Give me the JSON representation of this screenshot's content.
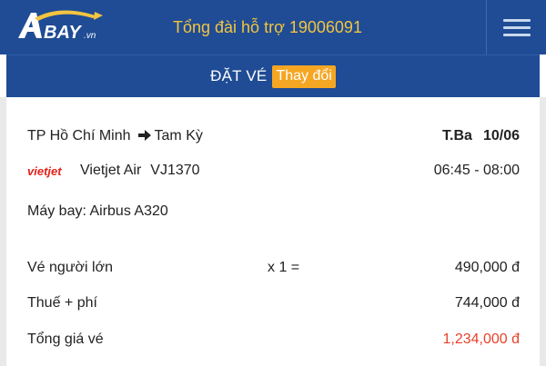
{
  "header": {
    "logo_text": "BAY",
    "logo_suffix": ".vn",
    "hotline": "Tổng đài hỗ trợ 19006091"
  },
  "subbar": {
    "title": "ĐẶT VÉ",
    "change_label": "Thay đổi"
  },
  "flight": {
    "origin": "TP Hồ Chí Minh",
    "destination": "Tam Kỳ",
    "weekday": "T.Ba",
    "date": "10/06",
    "airline_logo_text": "vietjet",
    "airline": "Vietjet Air",
    "flight_number": "VJ1370",
    "time_range": "06:45 - 08:00",
    "aircraft": "Máy bay: Airbus A320"
  },
  "pricing": {
    "adult_label": "Vé người lớn",
    "adult_qty": "x 1 =",
    "adult_price": "490,000 đ",
    "tax_label": "Thuế + phí",
    "tax_price": "744,000 đ",
    "total_label": "Tổng giá vé",
    "total_price": "1,234,000 đ"
  },
  "colors": {
    "header_bg": "#1f4c94",
    "hotline": "#f3c440",
    "change_button": "#f5a623",
    "total_price": "#e8412c"
  },
  "icons": {
    "menu": "hamburger-menu-icon",
    "route_arrow": "arrow-right-icon",
    "logo": "abay-logo"
  }
}
